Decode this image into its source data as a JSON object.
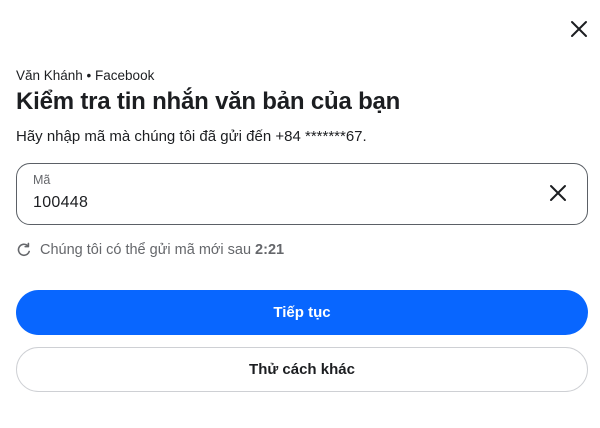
{
  "header": {
    "account_line": "Văn Khánh • Facebook",
    "title": "Kiểm tra tin nhắn văn bản của bạn",
    "subtitle": "Hãy nhập mã mà chúng tôi đã gửi đến +84 *******67."
  },
  "code_field": {
    "label": "Mã",
    "value": "100448"
  },
  "resend": {
    "text": "Chúng tôi có thể gửi mã mới sau",
    "timer": "2:21"
  },
  "actions": {
    "continue_label": "Tiếp tục",
    "other_way_label": "Thử cách khác"
  },
  "icons": {
    "close": "close-icon",
    "clear": "clear-icon",
    "refresh": "refresh-icon"
  },
  "colors": {
    "primary": "#0866ff",
    "text": "#1c1e21",
    "secondary_text": "#65676b",
    "border": "#ced0d4"
  }
}
